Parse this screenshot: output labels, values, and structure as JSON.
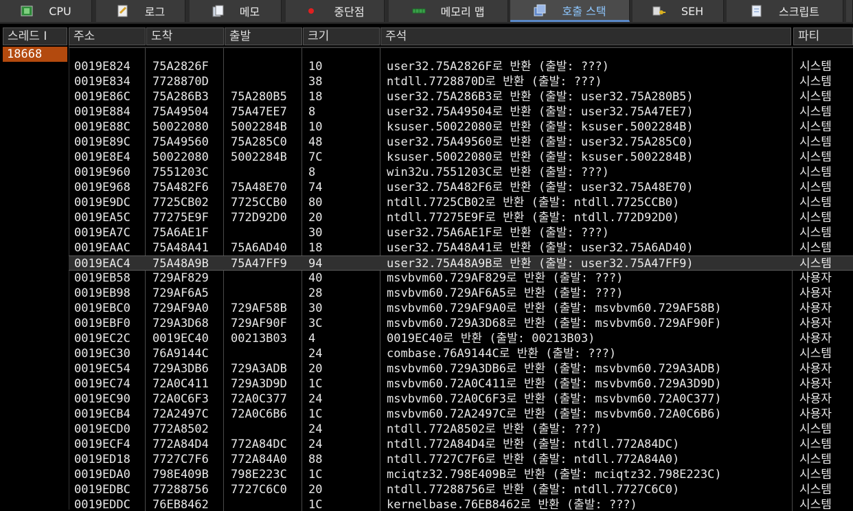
{
  "tabs": [
    {
      "label": "CPU",
      "icon": "cpu-chip-icon",
      "active": false
    },
    {
      "label": "로그",
      "icon": "log-notepad-icon",
      "active": false
    },
    {
      "label": "메모",
      "icon": "notes-icon",
      "active": false
    },
    {
      "label": "중단점",
      "icon": "breakpoint-dot-icon",
      "active": false
    },
    {
      "label": "메모리 맵",
      "icon": "memory-map-icon",
      "active": false
    },
    {
      "label": "호출 스택",
      "icon": "call-stack-icon",
      "active": true
    },
    {
      "label": "SEH",
      "icon": "seh-key-icon",
      "active": false
    },
    {
      "label": "스크립트",
      "icon": "script-icon",
      "active": false
    }
  ],
  "threads": {
    "header": "스레드 I",
    "items": [
      "18668"
    ]
  },
  "columns": {
    "address": "주소",
    "to": "도착",
    "from": "출발",
    "size": "크기",
    "comment": "주석",
    "party": "파티"
  },
  "rows": [
    {
      "address": "0019E824",
      "to": "75A2826F",
      "from": "",
      "size": "10",
      "comment": "user32.75A2826F로 반환 (출발: ???)",
      "party": "시스템"
    },
    {
      "address": "0019E834",
      "to": "7728870D",
      "from": "",
      "size": "38",
      "comment": "ntdll.7728870D로 반환 (출발: ???)",
      "party": "시스템"
    },
    {
      "address": "0019E86C",
      "to": "75A286B3",
      "from": "75A280B5",
      "size": "18",
      "comment": "user32.75A286B3로 반환 (출발: user32.75A280B5)",
      "party": "시스템"
    },
    {
      "address": "0019E884",
      "to": "75A49504",
      "from": "75A47EE7",
      "size": "8",
      "comment": "user32.75A49504로 반환 (출발: user32.75A47EE7)",
      "party": "시스템"
    },
    {
      "address": "0019E88C",
      "to": "50022080",
      "from": "5002284B",
      "size": "10",
      "comment": "ksuser.50022080로 반환 (출발: ksuser.5002284B)",
      "party": "시스템"
    },
    {
      "address": "0019E89C",
      "to": "75A49560",
      "from": "75A285C0",
      "size": "48",
      "comment": "user32.75A49560로 반환 (출발: user32.75A285C0)",
      "party": "시스템"
    },
    {
      "address": "0019E8E4",
      "to": "50022080",
      "from": "5002284B",
      "size": "7C",
      "comment": "ksuser.50022080로 반환 (출발: ksuser.5002284B)",
      "party": "시스템"
    },
    {
      "address": "0019E960",
      "to": "7551203C",
      "from": "",
      "size": "8",
      "comment": "win32u.7551203C로 반환 (출발: ???)",
      "party": "시스템"
    },
    {
      "address": "0019E968",
      "to": "75A482F6",
      "from": "75A48E70",
      "size": "74",
      "comment": "user32.75A482F6로 반환 (출발: user32.75A48E70)",
      "party": "시스템"
    },
    {
      "address": "0019E9DC",
      "to": "7725CB02",
      "from": "7725CCB0",
      "size": "80",
      "comment": "ntdll.7725CB02로 반환 (출발: ntdll.7725CCB0)",
      "party": "시스템"
    },
    {
      "address": "0019EA5C",
      "to": "77275E9F",
      "from": "772D92D0",
      "size": "20",
      "comment": "ntdll.77275E9F로 반환 (출발: ntdll.772D92D0)",
      "party": "시스템"
    },
    {
      "address": "0019EA7C",
      "to": "75A6AE1F",
      "from": "",
      "size": "30",
      "comment": "user32.75A6AE1F로 반환 (출발: ???)",
      "party": "시스템"
    },
    {
      "address": "0019EAAC",
      "to": "75A48A41",
      "from": "75A6AD40",
      "size": "18",
      "comment": "user32.75A48A41로 반환 (출발: user32.75A6AD40)",
      "party": "시스템"
    },
    {
      "address": "0019EAC4",
      "to": "75A48A9B",
      "from": "75A47FF9",
      "size": "94",
      "comment": "user32.75A48A9B로 반환 (출발: user32.75A47FF9)",
      "party": "시스템",
      "selected": true
    },
    {
      "address": "0019EB58",
      "to": "729AF829",
      "from": "",
      "size": "40",
      "comment": "msvbvm60.729AF829로 반환 (출발: ???)",
      "party": "사용자"
    },
    {
      "address": "0019EB98",
      "to": "729AF6A5",
      "from": "",
      "size": "28",
      "comment": "msvbvm60.729AF6A5로 반환 (출발: ???)",
      "party": "사용자"
    },
    {
      "address": "0019EBC0",
      "to": "729AF9A0",
      "from": "729AF58B",
      "size": "30",
      "comment": "msvbvm60.729AF9A0로 반환 (출발: msvbvm60.729AF58B)",
      "party": "사용자"
    },
    {
      "address": "0019EBF0",
      "to": "729A3D68",
      "from": "729AF90F",
      "size": "3C",
      "comment": "msvbvm60.729A3D68로 반환 (출발: msvbvm60.729AF90F)",
      "party": "사용자"
    },
    {
      "address": "0019EC2C",
      "to": "0019EC40",
      "from": "00213B03",
      "size": "4",
      "comment": "0019EC40로 반환 (출발: 00213B03)",
      "party": "사용자"
    },
    {
      "address": "0019EC30",
      "to": "76A9144C",
      "from": "",
      "size": "24",
      "comment": "combase.76A9144C로 반환 (출발: ???)",
      "party": "시스템"
    },
    {
      "address": "0019EC54",
      "to": "729A3DB6",
      "from": "729A3ADB",
      "size": "20",
      "comment": "msvbvm60.729A3DB6로 반환 (출발: msvbvm60.729A3ADB)",
      "party": "사용자"
    },
    {
      "address": "0019EC74",
      "to": "72A0C411",
      "from": "729A3D9D",
      "size": "1C",
      "comment": "msvbvm60.72A0C411로 반환 (출발: msvbvm60.729A3D9D)",
      "party": "사용자"
    },
    {
      "address": "0019EC90",
      "to": "72A0C6F3",
      "from": "72A0C377",
      "size": "24",
      "comment": "msvbvm60.72A0C6F3로 반환 (출발: msvbvm60.72A0C377)",
      "party": "사용자"
    },
    {
      "address": "0019ECB4",
      "to": "72A2497C",
      "from": "72A0C6B6",
      "size": "1C",
      "comment": "msvbvm60.72A2497C로 반환 (출발: msvbvm60.72A0C6B6)",
      "party": "사용자"
    },
    {
      "address": "0019ECD0",
      "to": "772A8502",
      "from": "",
      "size": "24",
      "comment": "ntdll.772A8502로 반환 (출발: ???)",
      "party": "시스템"
    },
    {
      "address": "0019ECF4",
      "to": "772A84D4",
      "from": "772A84DC",
      "size": "24",
      "comment": "ntdll.772A84D4로 반환 (출발: ntdll.772A84DC)",
      "party": "시스템"
    },
    {
      "address": "0019ED18",
      "to": "7727C7F6",
      "from": "772A84A0",
      "size": "88",
      "comment": "ntdll.7727C7F6로 반환 (출발: ntdll.772A84A0)",
      "party": "시스템"
    },
    {
      "address": "0019EDA0",
      "to": "798E409B",
      "from": "798E223C",
      "size": "1C",
      "comment": "mciqtz32.798E409B로 반환 (출발: mciqtz32.798E223C)",
      "party": "시스템"
    },
    {
      "address": "0019EDBC",
      "to": "77288756",
      "from": "7727C6C0",
      "size": "20",
      "comment": "ntdll.77288756로 반환 (출발: ntdll.7727C6C0)",
      "party": "시스템"
    },
    {
      "address": "0019EDDC",
      "to": "76EB8462",
      "from": "",
      "size": "1C",
      "comment": "kernelbase.76EB8462로 반환 (출발: ???)",
      "party": "시스템"
    }
  ],
  "colors": {
    "background": "#000000",
    "thread_selected": "#b34a0e",
    "active_tab_text": "#8ec7ff",
    "active_tab_underline": "#5a88c8"
  }
}
